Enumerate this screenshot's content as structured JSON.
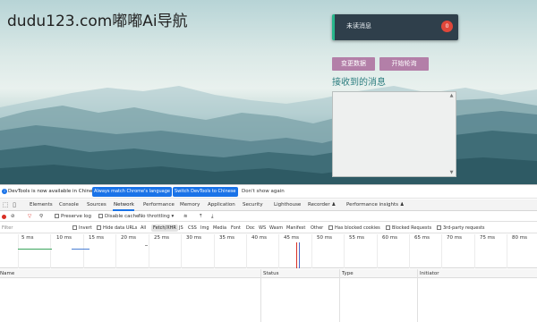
{
  "page": {
    "site_title": "dudu123.com嘟嘟Ai导航",
    "notify": {
      "text": "未读消息",
      "count": "0"
    },
    "buttons": {
      "switch_data": "变更数据",
      "start_poll": "开始轮询"
    },
    "received_label": "接收到的消息",
    "textarea_value": ""
  },
  "devtools": {
    "infobar": {
      "message": "DevTools is now available in Chinese!",
      "match_language": "Always match Chrome's language",
      "switch_chinese": "Switch DevTools to Chinese",
      "dismiss": "Don't show again"
    },
    "tabs": [
      "Elements",
      "Console",
      "Sources",
      "Network",
      "Performance",
      "Memory",
      "Application",
      "Security",
      "Lighthouse",
      "Recorder ♟",
      "Performance insights ♟"
    ],
    "active_tab": "Network",
    "toolbar": {
      "preserve_log": "Preserve log",
      "disable_cache": "Disable cache",
      "throttling": "No throttling"
    },
    "filter": {
      "placeholder": "Filter",
      "invert": "Invert",
      "hide_data_urls": "Hide data URLs",
      "types": [
        "All",
        "Fetch/XHR",
        "JS",
        "CSS",
        "Img",
        "Media",
        "Font",
        "Doc",
        "WS",
        "Wasm",
        "Manifest",
        "Other"
      ],
      "active_type": "Fetch/XHR",
      "has_blocked_cookies": "Has blocked cookies",
      "blocked_requests": "Blocked Requests",
      "third_party": "3rd-party requests"
    },
    "timeline_ticks": [
      "5 ms",
      "10 ms",
      "15 ms",
      "20 ms",
      "25 ms",
      "30 ms",
      "35 ms",
      "40 ms",
      "45 ms",
      "50 ms",
      "55 ms",
      "60 ms",
      "65 ms",
      "70 ms",
      "75 ms",
      "80 ms"
    ],
    "columns": [
      "Name",
      "Status",
      "Type",
      "Initiator"
    ]
  }
}
